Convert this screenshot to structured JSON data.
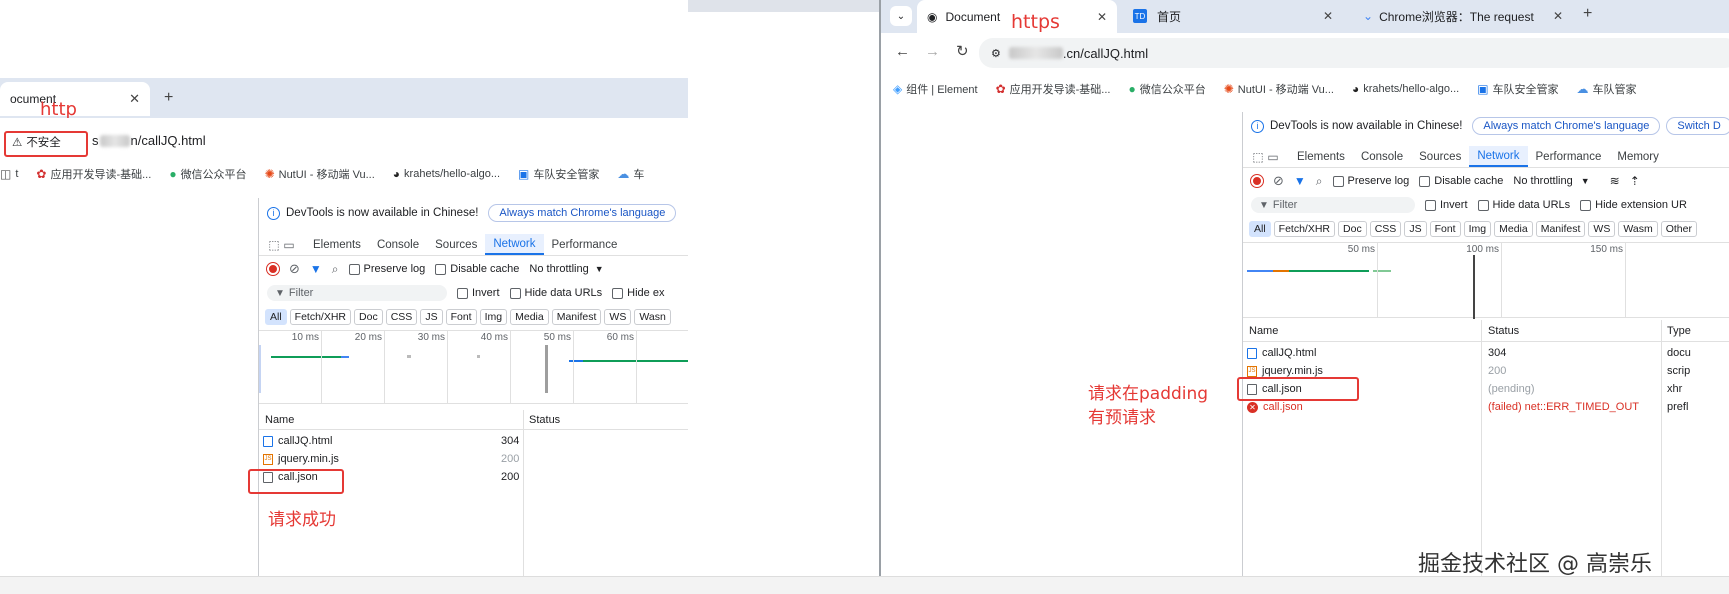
{
  "left": {
    "tab_title": "ocument",
    "protocol_note": "http",
    "insecure_label": "不安全",
    "url_prefix": "s",
    "url_suffix": "n/callJQ.html",
    "bookmarks": [
      {
        "icon": "bookmark-icon",
        "label": "t"
      },
      {
        "icon": "huawei-icon",
        "label": "应用开发导读-基础..."
      },
      {
        "icon": "wechat-icon",
        "label": "微信公众平台"
      },
      {
        "icon": "nutui-icon",
        "label": "NutUI - 移动端 Vu..."
      },
      {
        "icon": "github-icon",
        "label": "krahets/hello-algo..."
      },
      {
        "icon": "fleet-icon",
        "label": "车队安全管家"
      },
      {
        "icon": "cloud-icon",
        "label": "车"
      }
    ],
    "devtools_notice": "DevTools is now available in Chinese!",
    "match_lang_button": "Always match Chrome's language",
    "panels": [
      "Elements",
      "Console",
      "Sources",
      "Network",
      "Performance"
    ],
    "preserve_log": "Preserve log",
    "disable_cache": "Disable cache",
    "throttling": "No throttling",
    "filter_placeholder": "Filter",
    "invert": "Invert",
    "hide_data_urls": "Hide data URLs",
    "hide_ext": "Hide ex",
    "types": [
      "All",
      "Fetch/XHR",
      "Doc",
      "CSS",
      "JS",
      "Font",
      "Img",
      "Media",
      "Manifest",
      "WS",
      "Wasn"
    ],
    "ticks": [
      "10 ms",
      "20 ms",
      "30 ms",
      "40 ms",
      "50 ms",
      "60 ms"
    ],
    "col_name": "Name",
    "col_status": "Status",
    "requests": [
      {
        "name": "callJQ.html",
        "status": "304",
        "icon": "document-icon"
      },
      {
        "name": "jquery.min.js",
        "status": "200",
        "icon": "script-icon"
      },
      {
        "name": "call.json",
        "status": "200",
        "icon": "file-icon"
      }
    ],
    "annotation": "请求成功"
  },
  "right": {
    "tabs": [
      {
        "title": "Document",
        "icon": "globe-icon"
      },
      {
        "title": "首页",
        "icon": "td-icon"
      },
      {
        "title": "Chrome浏览器：The request",
        "icon": "chevron-logo-icon"
      }
    ],
    "new_tab": "+",
    "protocol_note": "https",
    "url_suffix": ".cn/callJQ.html",
    "bookmarks": [
      {
        "icon": "element-icon",
        "label": "组件 | Element"
      },
      {
        "icon": "huawei-icon",
        "label": "应用开发导读-基础..."
      },
      {
        "icon": "wechat-icon",
        "label": "微信公众平台"
      },
      {
        "icon": "nutui-icon",
        "label": "NutUI - 移动端 Vu..."
      },
      {
        "icon": "github-icon",
        "label": "krahets/hello-algo..."
      },
      {
        "icon": "td-icon",
        "label": "车队安全管家"
      },
      {
        "icon": "cloud-icon",
        "label": "车队管家"
      }
    ],
    "devtools_notice": "DevTools is now available in Chinese!",
    "match_lang_button": "Always match Chrome's language",
    "switch_button": "Switch D",
    "panels": [
      "Elements",
      "Console",
      "Sources",
      "Network",
      "Performance",
      "Memory"
    ],
    "preserve_log": "Preserve log",
    "disable_cache": "Disable cache",
    "throttling": "No throttling",
    "filter_placeholder": "Filter",
    "invert": "Invert",
    "hide_data_urls": "Hide data URLs",
    "hide_ext": "Hide extension UR",
    "types": [
      "All",
      "Fetch/XHR",
      "Doc",
      "CSS",
      "JS",
      "Font",
      "Img",
      "Media",
      "Manifest",
      "WS",
      "Wasm",
      "Other"
    ],
    "ticks": [
      "50 ms",
      "100 ms",
      "150 ms"
    ],
    "col_name": "Name",
    "col_status": "Status",
    "col_type": "Type",
    "requests": [
      {
        "name": "callJQ.html",
        "status": "304",
        "type": "docu",
        "icon": "document-icon"
      },
      {
        "name": "jquery.min.js",
        "status": "200",
        "type": "scrip",
        "icon": "script-icon"
      },
      {
        "name": "call.json",
        "status": "(pending)",
        "type": "xhr",
        "icon": "file-icon"
      },
      {
        "name": "call.json",
        "status": "(failed) net::ERR_TIMED_OUT",
        "type": "prefl",
        "icon": "error-icon"
      }
    ],
    "annotation_line1": "请求在padding",
    "annotation_line2": "有预请求"
  },
  "watermark": "掘金技术社区 @ 高崇乐",
  "colors": {
    "accent": "#1a73e8",
    "annotation": "#e53935",
    "error": "#d93025"
  }
}
